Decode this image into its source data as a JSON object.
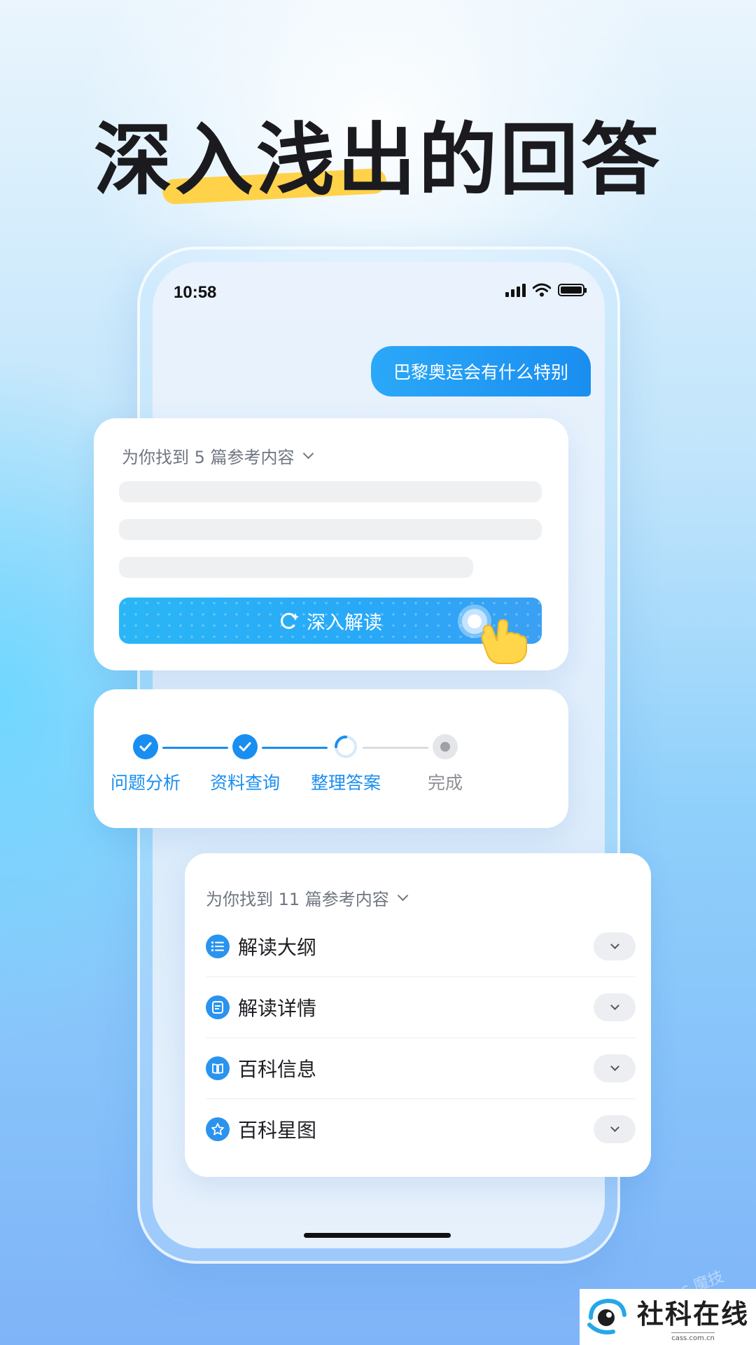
{
  "headline": {
    "text": "深入浅出的回答",
    "highlight_color": "#ffd24a"
  },
  "status_bar": {
    "time": "10:58",
    "icons": [
      "signal-icon",
      "wifi-icon",
      "battery-icon"
    ]
  },
  "chat": {
    "user_message": "巴黎奥运会有什么特别"
  },
  "card_search": {
    "refs_label": "为你找到 5 篇参考内容",
    "button_label": "深入解读",
    "button_icon": "refresh-sparkle-icon",
    "accent_color": "#28a8f7"
  },
  "card_progress": {
    "steps": [
      {
        "label": "问题分析",
        "state": "done"
      },
      {
        "label": "资料查询",
        "state": "done"
      },
      {
        "label": "整理答案",
        "state": "loading"
      },
      {
        "label": "完成",
        "state": "pending"
      }
    ],
    "active_color": "#1a8ef0",
    "pending_color": "#8c8f94"
  },
  "card_results": {
    "refs_label": "为你找到 11 篇参考内容",
    "sections": [
      {
        "label": "解读大纲",
        "icon": "list-icon"
      },
      {
        "label": "解读详情",
        "icon": "document-icon"
      },
      {
        "label": "百科信息",
        "icon": "book-icon"
      },
      {
        "label": "百科星图",
        "icon": "star-icon"
      }
    ]
  },
  "watermark": {
    "name": "社科在线",
    "url": "cass.com.cn",
    "faint_text": "mc 魔技"
  }
}
